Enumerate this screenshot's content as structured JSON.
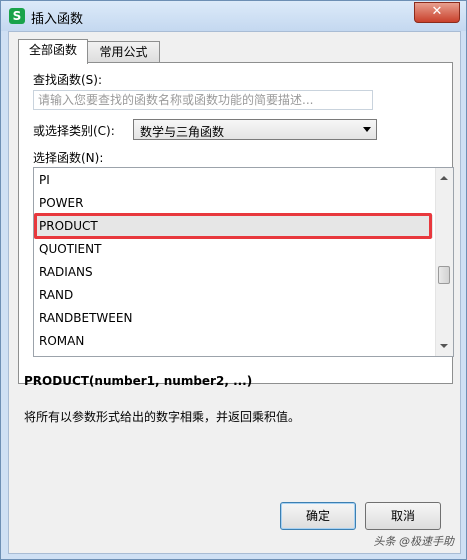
{
  "window": {
    "app_icon": "S",
    "title": "插入函数",
    "close_glyph": "✕"
  },
  "tabs": [
    {
      "label": "全部函数",
      "active": true
    },
    {
      "label": "常用公式",
      "active": false
    }
  ],
  "search": {
    "label": "查找函数(S):",
    "placeholder": "请输入您要查找的函数名称或函数功能的简要描述..."
  },
  "category": {
    "label": "或选择类别(C):",
    "value": "数学与三角函数"
  },
  "function_list": {
    "label": "选择函数(N):",
    "items": [
      "PI",
      "POWER",
      "PRODUCT",
      "QUOTIENT",
      "RADIANS",
      "RAND",
      "RANDBETWEEN",
      "ROMAN"
    ],
    "selected": "PRODUCT",
    "highlight_color": "#e8383d"
  },
  "detail": {
    "signature": "PRODUCT(number1, number2, ...)",
    "description": "将所有以参数形式给出的数字相乘，并返回乘积值。"
  },
  "buttons": {
    "ok": "确定",
    "cancel": "取消"
  },
  "watermark": "头条 @极速手助"
}
